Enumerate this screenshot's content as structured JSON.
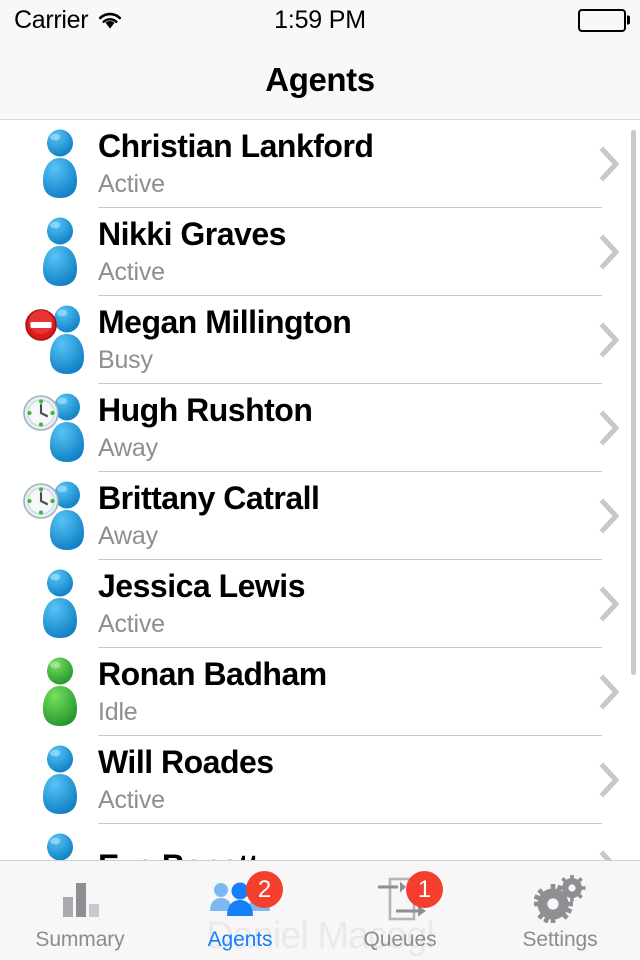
{
  "status_bar": {
    "carrier": "Carrier",
    "wifi_icon": "wifi-icon",
    "time": "1:59 PM",
    "battery_icon": "battery-full-icon"
  },
  "nav": {
    "title": "Agents"
  },
  "colors": {
    "accent": "#147efb",
    "badge": "#f53f2e",
    "status_text": "#8e8e93",
    "separator": "#c8c7cc",
    "chevron": "#c7c7cc",
    "bar_background": "#f7f7f7",
    "person_blue": "#1f9ae0",
    "person_green": "#3cbf33"
  },
  "agents": [
    {
      "name": "Christian Lankford",
      "status": "Active",
      "presence": "active",
      "icon": "person-blue-icon"
    },
    {
      "name": "Nikki Graves",
      "status": "Active",
      "presence": "active",
      "icon": "person-blue-icon"
    },
    {
      "name": "Megan Millington",
      "status": "Busy",
      "presence": "busy",
      "icon": "person-busy-icon"
    },
    {
      "name": "Hugh Rushton",
      "status": "Away",
      "presence": "away",
      "icon": "person-away-icon"
    },
    {
      "name": "Brittany Catrall",
      "status": "Away",
      "presence": "away",
      "icon": "person-away-icon"
    },
    {
      "name": "Jessica Lewis",
      "status": "Active",
      "presence": "active",
      "icon": "person-blue-icon"
    },
    {
      "name": "Ronan Badham",
      "status": "Idle",
      "presence": "idle",
      "icon": "person-green-icon"
    },
    {
      "name": "Will Roades",
      "status": "Active",
      "presence": "active",
      "icon": "person-blue-icon"
    },
    {
      "name": "Eva Benett",
      "status": "",
      "presence": "active",
      "icon": "person-blue-icon"
    }
  ],
  "tabs": [
    {
      "label": "Summary",
      "icon": "bar-chart-icon",
      "active": false,
      "badge": ""
    },
    {
      "label": "Agents",
      "icon": "people-icon",
      "active": true,
      "badge": "2"
    },
    {
      "label": "Queues",
      "icon": "queue-flow-icon",
      "active": false,
      "badge": "1"
    },
    {
      "label": "Settings",
      "icon": "gears-icon",
      "active": false,
      "badge": ""
    }
  ],
  "watermark": "Daniel Macogl"
}
